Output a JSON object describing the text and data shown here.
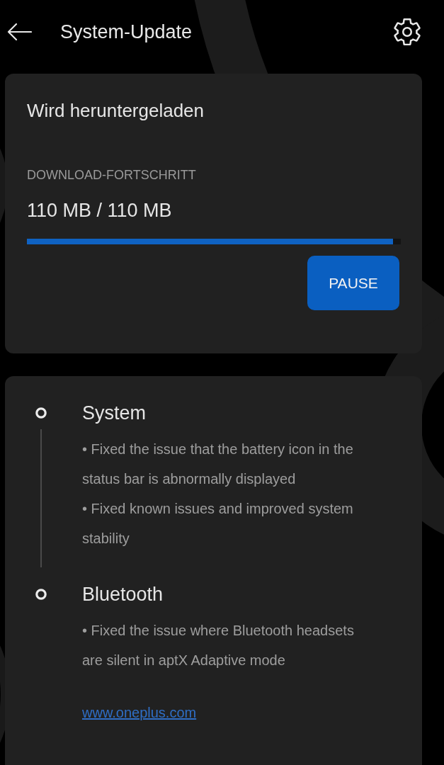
{
  "header": {
    "title": "System-Update"
  },
  "download": {
    "status": "Wird heruntergeladen",
    "label": "DOWNLOAD-FORTSCHRITT",
    "progress_text": "110 MB / 110 MB",
    "level": 0.98,
    "button": "PAUSE"
  },
  "changelog": {
    "sections": [
      {
        "title": "System",
        "items": [
          "• Fixed the issue that the battery icon in the status bar is abnormally displayed",
          "• Fixed known issues and improved system stability"
        ]
      },
      {
        "title": "Bluetooth",
        "items": [
          "• Fixed the issue where Bluetooth headsets are silent in aptX Adaptive mode"
        ]
      }
    ],
    "link": "www.oneplus.com"
  }
}
